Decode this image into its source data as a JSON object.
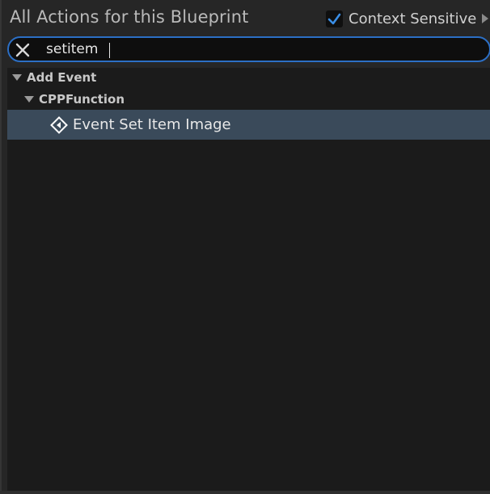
{
  "header": {
    "title": "All Actions for this Blueprint",
    "context_sensitive": {
      "label": "Context Sensitive",
      "checked": true
    }
  },
  "search": {
    "value": "setitem",
    "placeholder": ""
  },
  "tree": {
    "categories": [
      {
        "label": "Add Event",
        "expanded": true,
        "children": [
          {
            "label": "CPPFunction",
            "expanded": true,
            "items": [
              {
                "label": "Event Set Item Image",
                "icon": "event-icon",
                "selected": true
              }
            ]
          }
        ]
      }
    ]
  },
  "colors": {
    "accent": "#2c6fc5",
    "selection": "#3a4a5a",
    "checkmark": "#3a8ee6"
  }
}
